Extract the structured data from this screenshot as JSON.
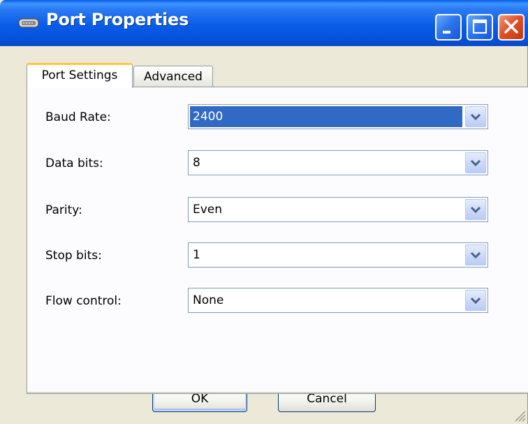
{
  "window": {
    "title": "Port Properties",
    "title_icon": "serial-port-icon",
    "buttons": {
      "minimize": "minimize-icon",
      "maximize": "maximize-icon",
      "close": "close-icon"
    }
  },
  "tabs": [
    {
      "label": "Port Settings",
      "active": true
    },
    {
      "label": "Advanced",
      "active": false
    }
  ],
  "fields": [
    {
      "label": "Baud Rate:",
      "value": "2400",
      "focused": true
    },
    {
      "label": "Data bits:",
      "value": "8"
    },
    {
      "label": "Parity:",
      "value": "Even"
    },
    {
      "label": "Stop bits:",
      "value": "1"
    },
    {
      "label": "Flow control:",
      "value": "None"
    }
  ],
  "buttons": {
    "ok": "OK",
    "cancel": "Cancel"
  },
  "colors": {
    "titlebar": "#0a5ce8",
    "dialog_bg": "#ece9d8",
    "selection": "#316ac5",
    "active_tab_accent": "#ffc83c",
    "close_button": "#e2512a"
  }
}
